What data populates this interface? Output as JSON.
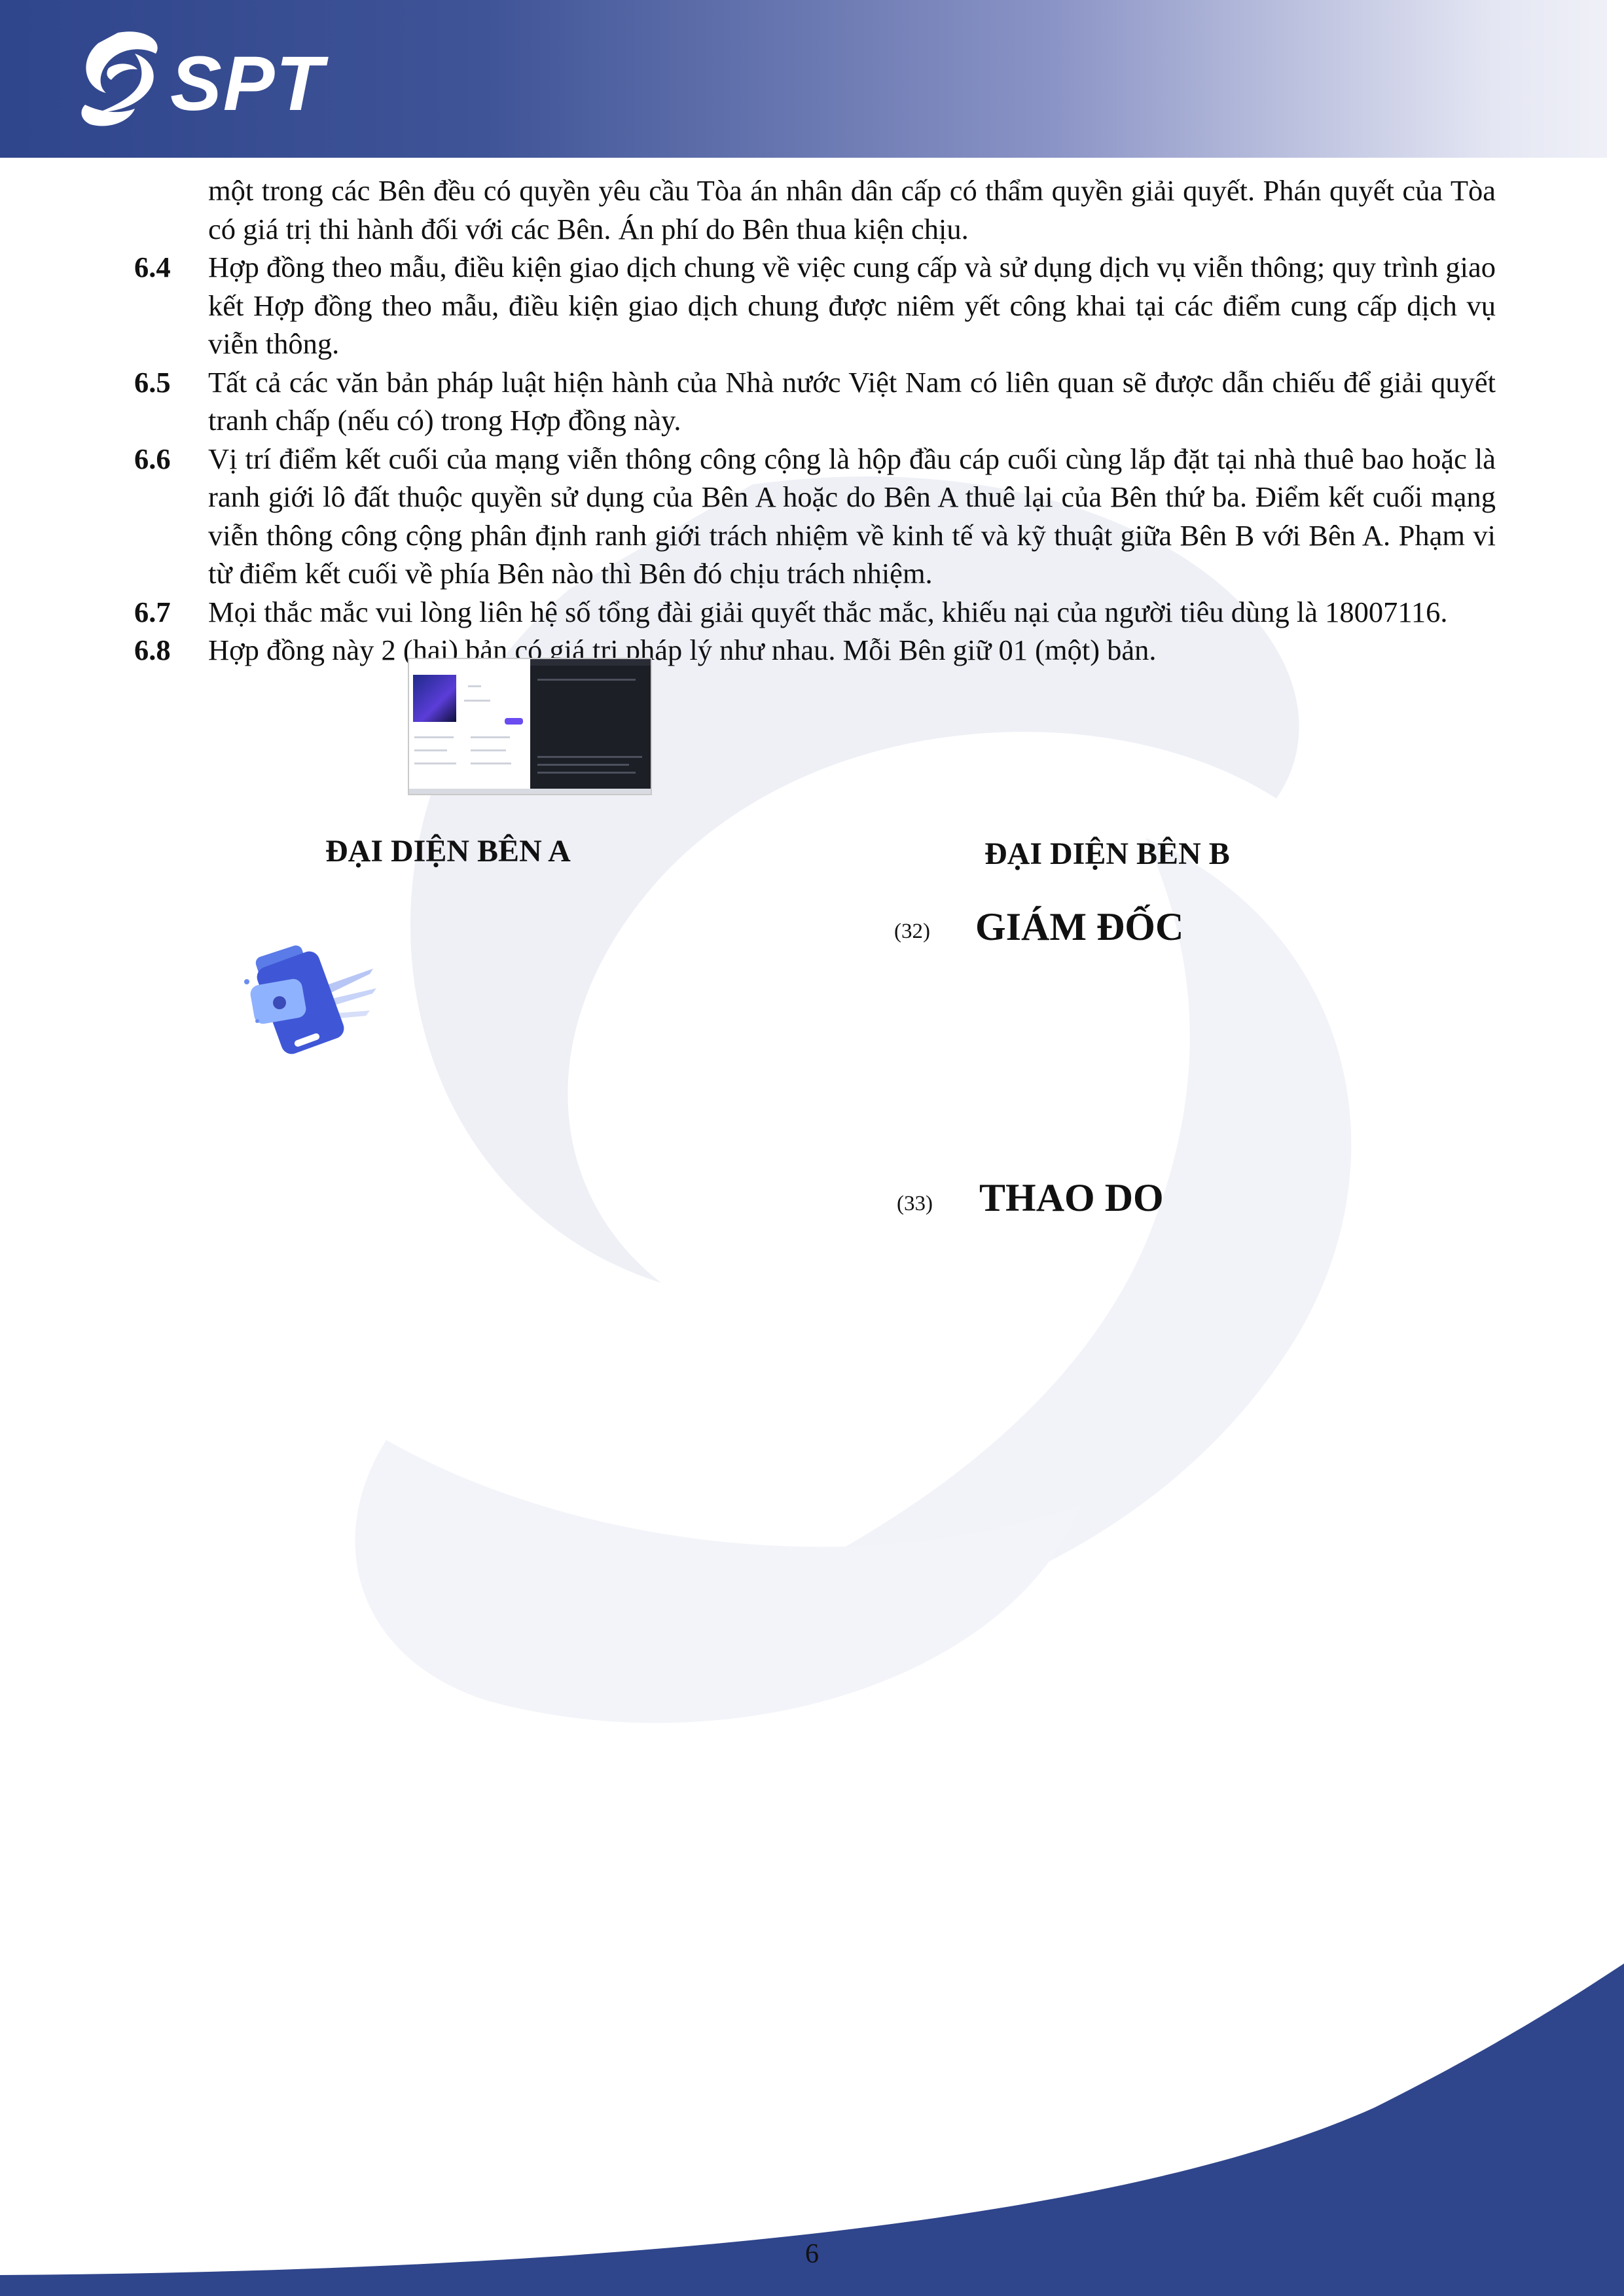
{
  "header": {
    "logo_text": "SPT",
    "colors": {
      "band_dark": "#2f458c",
      "band_light": "#e4e6f3"
    }
  },
  "body": {
    "intro": "một trong các Bên đều có quyền yêu cầu Tòa án nhân dân cấp có thẩm quyền giải quyết. Phán quyết của Tòa có giá trị thi hành đối với các Bên. Án phí do Bên thua kiện chịu.",
    "clauses": [
      {
        "num": "6.4",
        "text": "Hợp đồng theo mẫu, điều kiện giao dịch chung về việc cung cấp và sử dụng dịch vụ viễn thông; quy trình giao kết Hợp đồng theo mẫu, điều kiện giao dịch chung được niêm yết công khai tại các điểm cung cấp dịch vụ viễn thông."
      },
      {
        "num": "6.5",
        "text": "Tất cả các văn bản pháp luật hiện hành của Nhà nước Việt Nam có liên quan sẽ được dẫn chiếu để giải quyết tranh chấp (nếu có) trong Hợp đồng này."
      },
      {
        "num": "6.6",
        "text": "Vị trí điểm kết cuối của mạng viễn thông công cộng là hộp đầu cáp cuối cùng lắp đặt tại nhà thuê bao hoặc là ranh giới lô đất thuộc quyền sử dụng của Bên A hoặc do Bên A thuê lại của Bên thứ ba. Điểm kết cuối mạng viễn thông công cộng phân định ranh giới trách nhiệm về kinh tế và kỹ thuật giữa Bên B với Bên A. Phạm vi từ điểm kết cuối về phía Bên nào thì Bên đó chịu trách nhiệm."
      },
      {
        "num": "6.7",
        "text": "Mọi thắc mắc vui lòng liên hệ số tổng đài giải quyết thắc mắc, khiếu nại của người tiêu dùng là 18007116."
      },
      {
        "num": "6.8",
        "text": "Hợp đồng này 2 (hai) bản có giá trị pháp lý như nhau. Mỗi Bên giữ 01 (một) bản."
      }
    ]
  },
  "signatures": {
    "party_a_label": "ĐẠI DIỆN BÊN A",
    "party_b_label": "ĐẠI DIỆN BÊN B",
    "ref_32": "(32)",
    "party_b_title": "GIÁM ĐỐC",
    "ref_33": "(33)",
    "party_b_name": "THAO DO"
  },
  "footer": {
    "page_number": "6",
    "band_color": "#2f458c"
  }
}
